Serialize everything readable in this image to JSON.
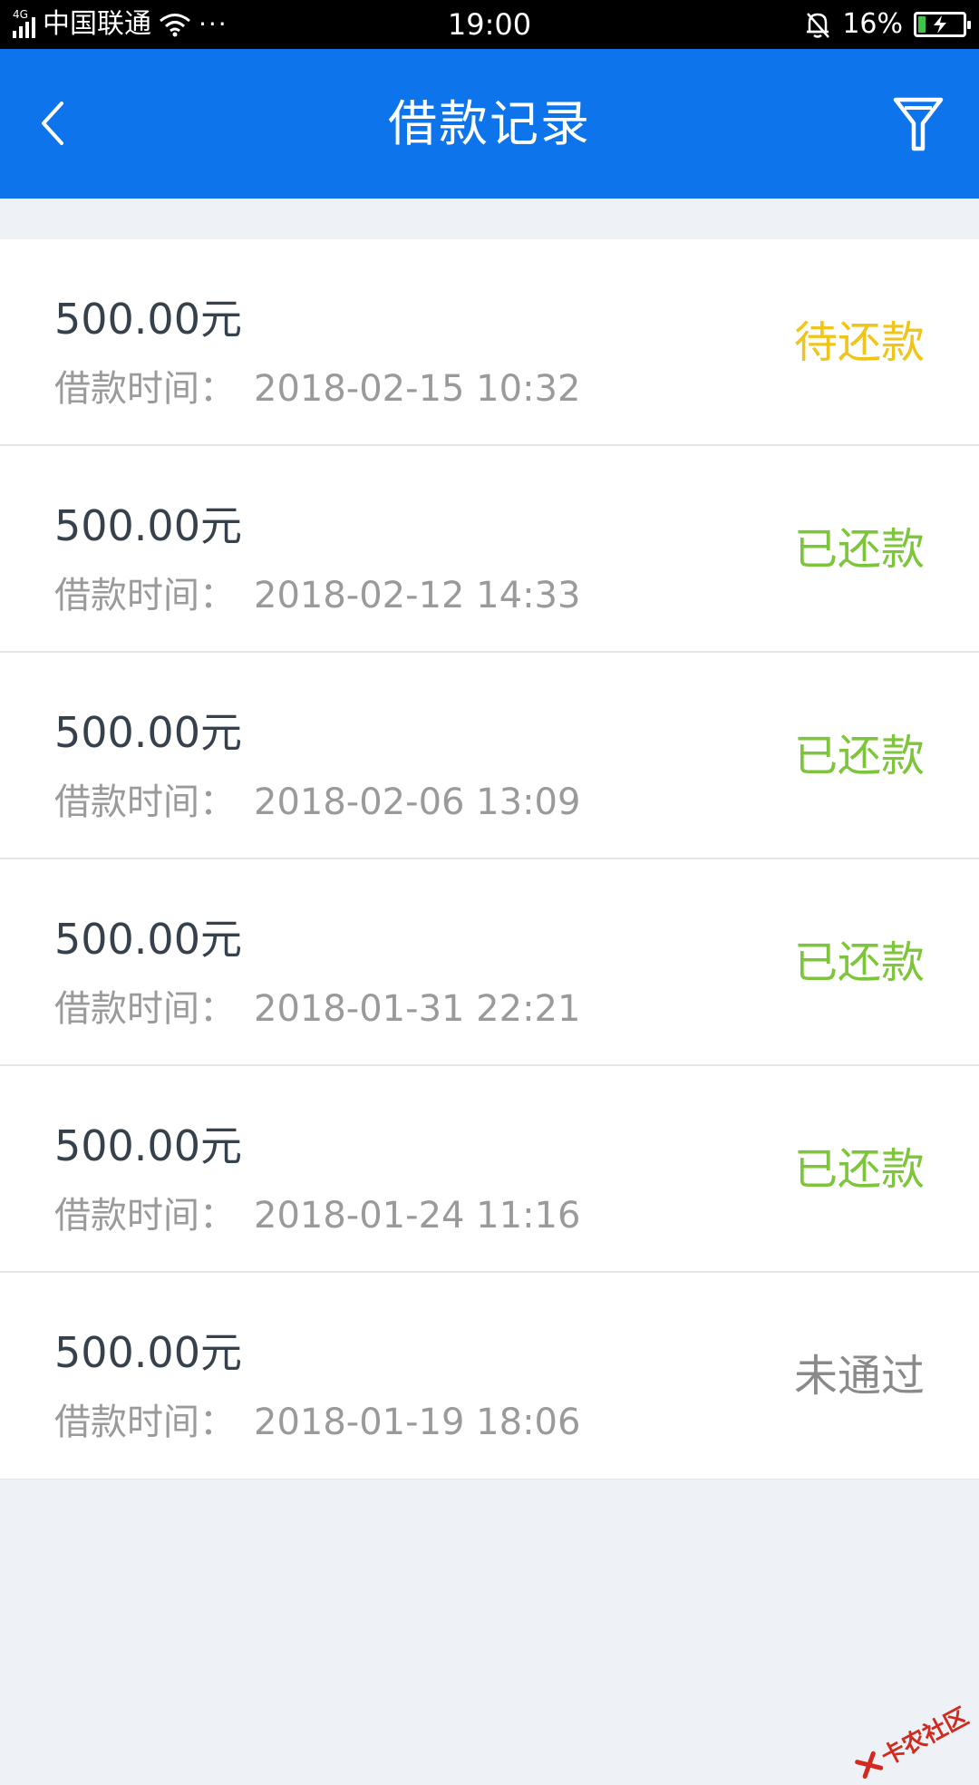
{
  "status_bar": {
    "network_tag": "4G",
    "carrier": "中国联通",
    "more": "···",
    "time": "19:00",
    "battery_text": "16%",
    "battery_level": 0.16,
    "battery_color": "#3ec447",
    "icons": [
      "signal-icon",
      "wifi-icon",
      "bell-muted-icon",
      "battery-charging-icon"
    ]
  },
  "nav": {
    "title": "借款记录",
    "background": "#0d74ec",
    "back_icon": "chevron-left-icon",
    "filter_icon": "filter-icon"
  },
  "records": [
    {
      "amount": "500.00元",
      "date_label": "借款时间：",
      "date": "2018-02-15 10:32",
      "status": "待还款",
      "status_color": "#f0c419"
    },
    {
      "amount": "500.00元",
      "date_label": "借款时间：",
      "date": "2018-02-12 14:33",
      "status": "已还款",
      "status_color": "#7dc53a"
    },
    {
      "amount": "500.00元",
      "date_label": "借款时间：",
      "date": "2018-02-06 13:09",
      "status": "已还款",
      "status_color": "#7dc53a"
    },
    {
      "amount": "500.00元",
      "date_label": "借款时间：",
      "date": "2018-01-31 22:21",
      "status": "已还款",
      "status_color": "#7dc53a"
    },
    {
      "amount": "500.00元",
      "date_label": "借款时间：",
      "date": "2018-01-24 11:16",
      "status": "已还款",
      "status_color": "#7dc53a"
    },
    {
      "amount": "500.00元",
      "date_label": "借款时间：",
      "date": "2018-01-19 18:06",
      "status": "未通过",
      "status_color": "#8a8a8a"
    }
  ],
  "watermark": "卡农社区"
}
